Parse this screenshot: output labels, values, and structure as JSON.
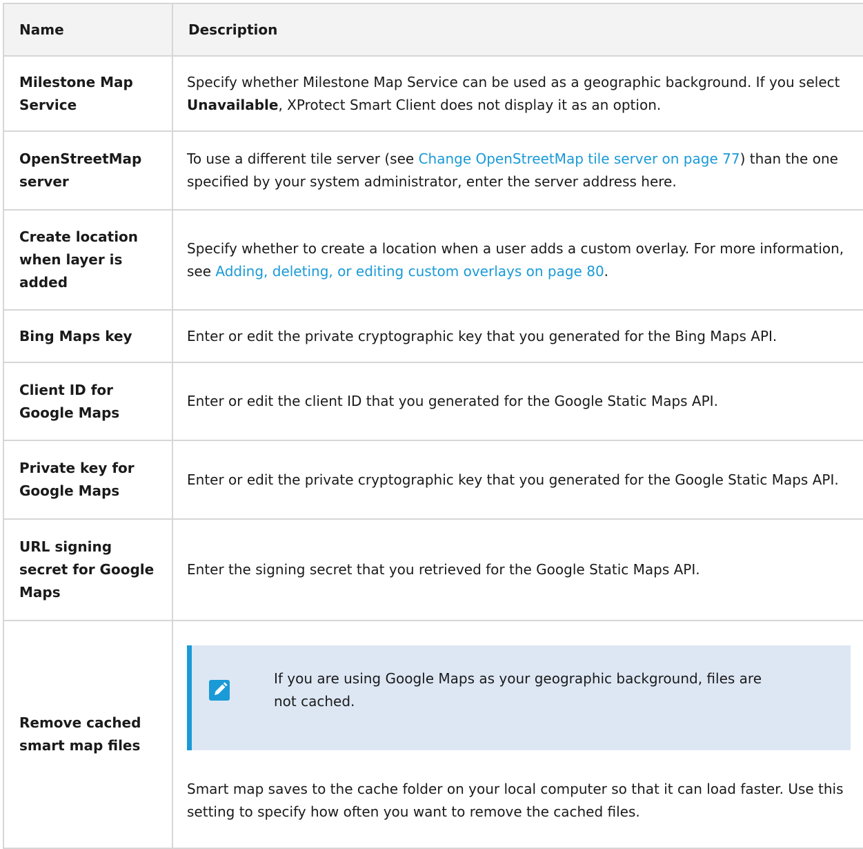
{
  "header": {
    "name": "Name",
    "description": "Description"
  },
  "rows": [
    {
      "name": "Milestone Map Service",
      "desc_before": "Specify whether Milestone Map Service can be used as a geographic background. If you select ",
      "desc_bold": "Unavailable",
      "desc_after": ", XProtect Smart Client does not display it as an option."
    },
    {
      "name": "OpenStreetMap server",
      "desc_before": "To use a different tile server (see ",
      "desc_link": "Change OpenStreetMap tile server on page 77",
      "desc_after": ") than the one specified by your system administrator, enter the server address here."
    },
    {
      "name": "Create location when layer is added",
      "desc_before": "Specify whether to create a location when a user adds a custom overlay. For more information, see ",
      "desc_link": "Adding, deleting, or editing custom overlays on page 80",
      "desc_after": "."
    },
    {
      "name": "Bing Maps key",
      "desc": "Enter or edit the private cryptographic key that you generated for the Bing Maps API."
    },
    {
      "name": "Client ID for Google Maps",
      "desc": "Enter or edit the client ID that you generated for the Google Static Maps API."
    },
    {
      "name": "Private key for Google Maps",
      "desc": "Enter or edit the private cryptographic key that you generated for the Google Static Maps API."
    },
    {
      "name": "URL signing secret for Google Maps",
      "desc": "Enter the signing secret that you retrieved for the Google Static Maps API."
    },
    {
      "name": "Remove cached smart map files",
      "note": "If you are using Google Maps as your geographic background, files are not cached.",
      "desc": "Smart map saves to the cache folder on your local computer so that it can load faster. Use this setting to specify how often you want to remove the cached files."
    }
  ],
  "colors": {
    "link": "#1a9ad6",
    "note_bg": "#dde7f4",
    "header_bg": "#f3f3f3",
    "border": "#d6d6d6"
  },
  "icons": {
    "note": "pencil-icon"
  }
}
